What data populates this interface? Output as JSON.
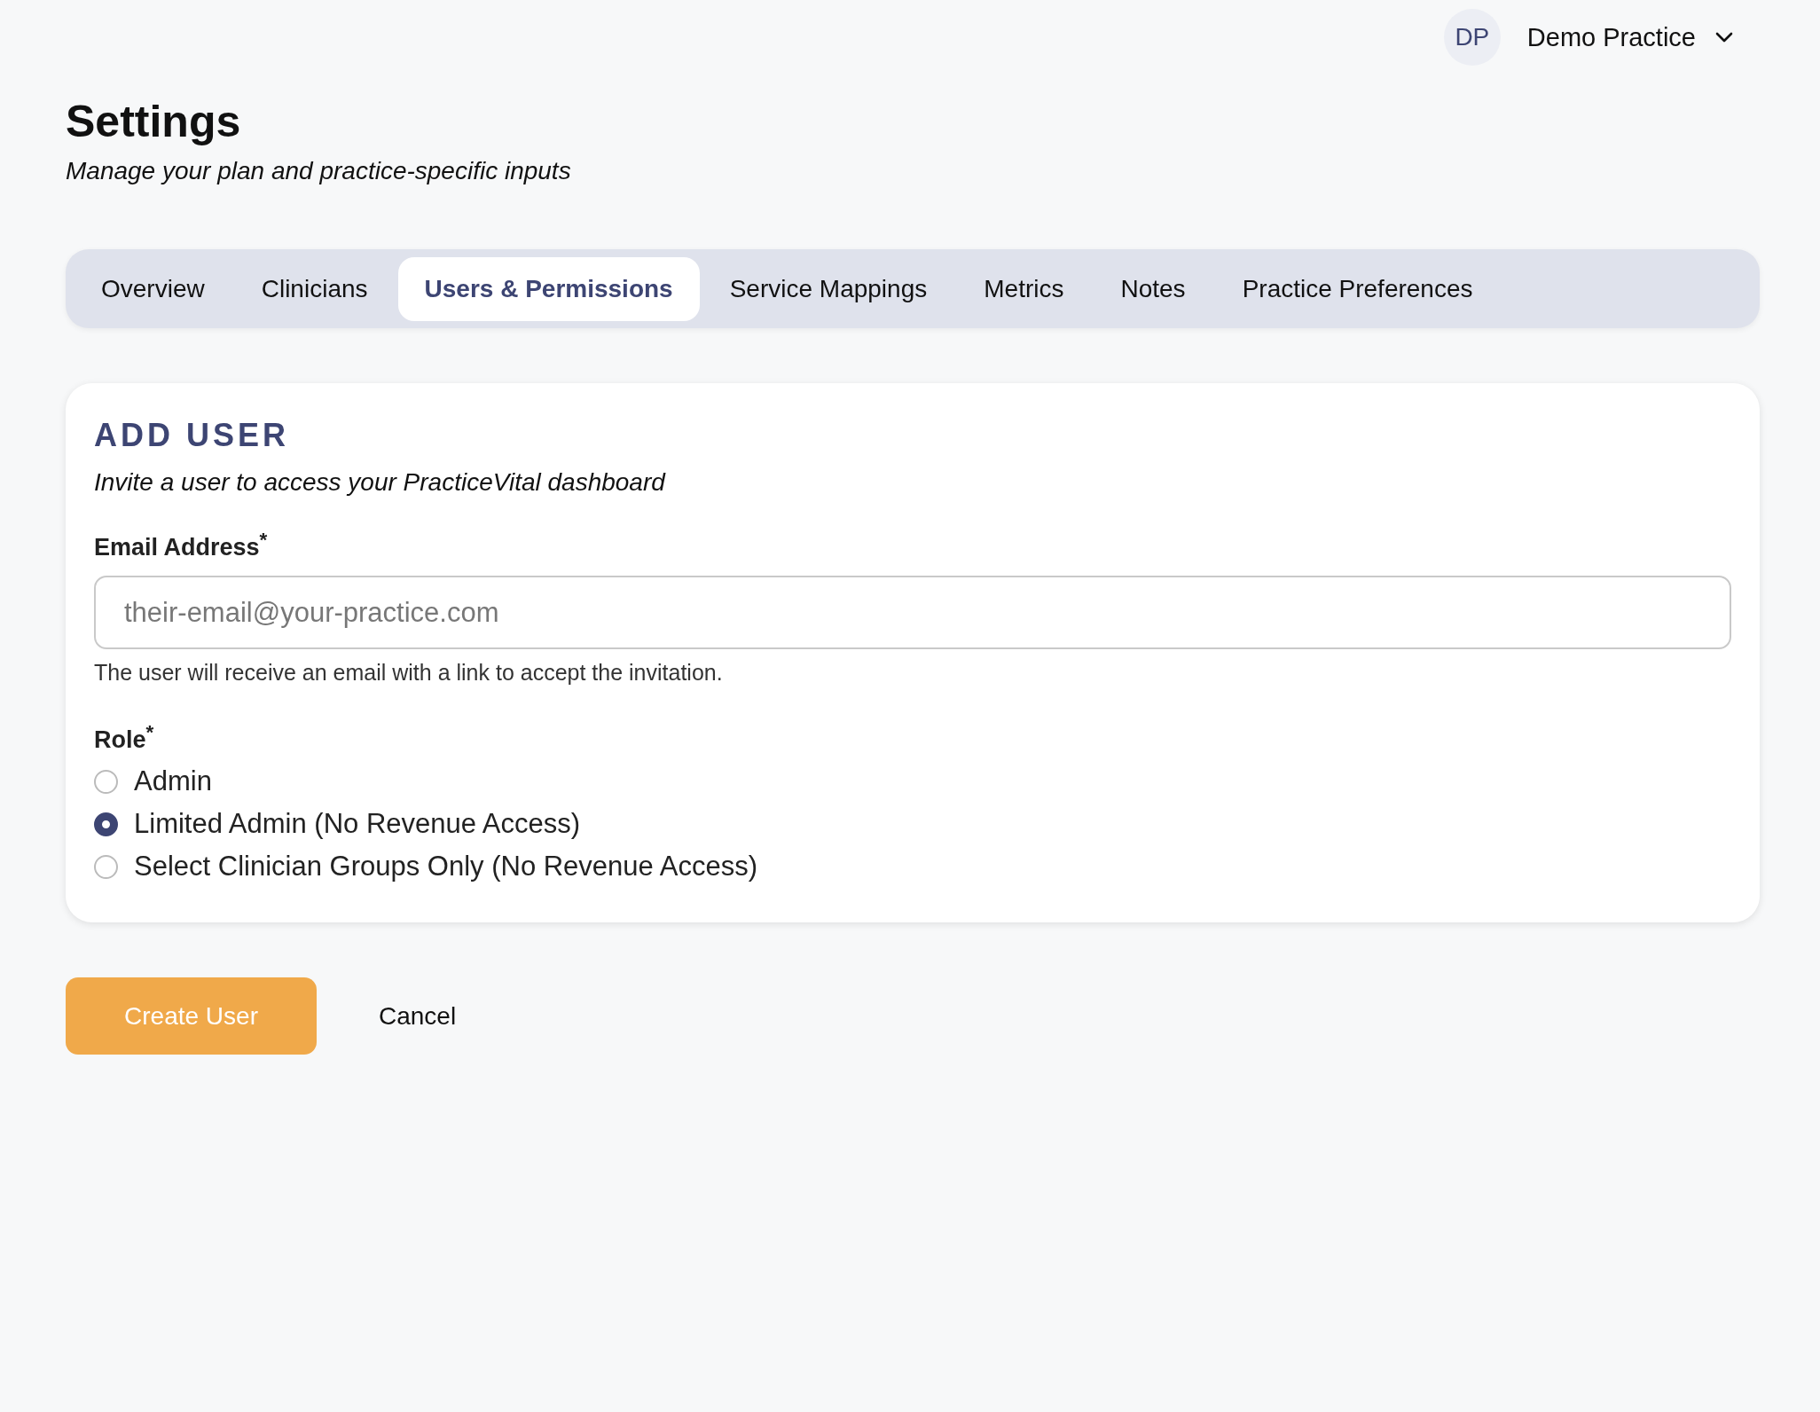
{
  "header": {
    "avatar_initials": "DP",
    "practice_name": "Demo Practice"
  },
  "page": {
    "title": "Settings",
    "subtitle": "Manage your plan and practice-specific inputs"
  },
  "tabs": [
    {
      "label": "Overview",
      "selected": false
    },
    {
      "label": "Clinicians",
      "selected": false
    },
    {
      "label": "Users & Permissions",
      "selected": true
    },
    {
      "label": "Service Mappings",
      "selected": false
    },
    {
      "label": "Metrics",
      "selected": false
    },
    {
      "label": "Notes",
      "selected": false
    },
    {
      "label": "Practice Preferences",
      "selected": false
    }
  ],
  "card": {
    "title": "ADD USER",
    "subtitle": "Invite a user to access your PracticeVital dashboard",
    "email": {
      "label": "Email Address$^{*}$",
      "placeholder": "their-email@your-practice.com",
      "help": "The user will receive an email with a link to accept the invitation."
    },
    "role": {
      "label": "Role$^{*}$",
      "options": [
        {
          "label": "Admin",
          "selected": false
        },
        {
          "label": "Limited Admin (No Revenue Access)",
          "selected": true
        },
        {
          "label": "Select Clinician Groups Only (No Revenue Access)",
          "selected": false
        }
      ]
    }
  },
  "buttons": {
    "primary": "Create User",
    "secondary": "Cancel"
  }
}
